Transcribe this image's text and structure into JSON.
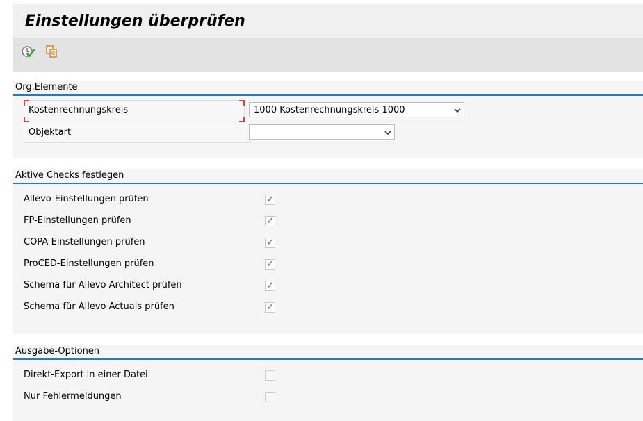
{
  "header": {
    "title": "Einstellungen überprüfen"
  },
  "toolbar": {
    "buttons": [
      {
        "icon": "execute-check-icon"
      },
      {
        "icon": "copy-variant-icon"
      }
    ]
  },
  "sections": {
    "org": {
      "title": "Org.Elemente",
      "fields": [
        {
          "label": "Kostenrechnungskreis",
          "value": "1000 Kostenrechnungskreis 1000",
          "required": true
        },
        {
          "label": "Objektart",
          "value": ""
        }
      ]
    },
    "checks": {
      "title": "Aktive Checks festlegen",
      "items": [
        {
          "label": "Allevo-Einstellungen prüfen",
          "checked": true
        },
        {
          "label": "FP-Einstellungen prüfen",
          "checked": true
        },
        {
          "label": "COPA-Einstellungen prüfen",
          "checked": true
        },
        {
          "label": "ProCED-Einstellungen prüfen",
          "checked": true
        },
        {
          "label": "Schema für Allevo Architect prüfen",
          "checked": true
        },
        {
          "label": "Schema für Allevo Actuals prüfen",
          "checked": true
        }
      ]
    },
    "output": {
      "title": "Ausgabe-Optionen",
      "items": [
        {
          "label": "Direkt-Export in einer Datei",
          "checked": false
        },
        {
          "label": "Nur Fehlermeldungen",
          "checked": false
        }
      ]
    }
  },
  "colors": {
    "accent": "#2b7cbf",
    "check": "#2a7dc9",
    "required_marker": "#d9453a"
  }
}
